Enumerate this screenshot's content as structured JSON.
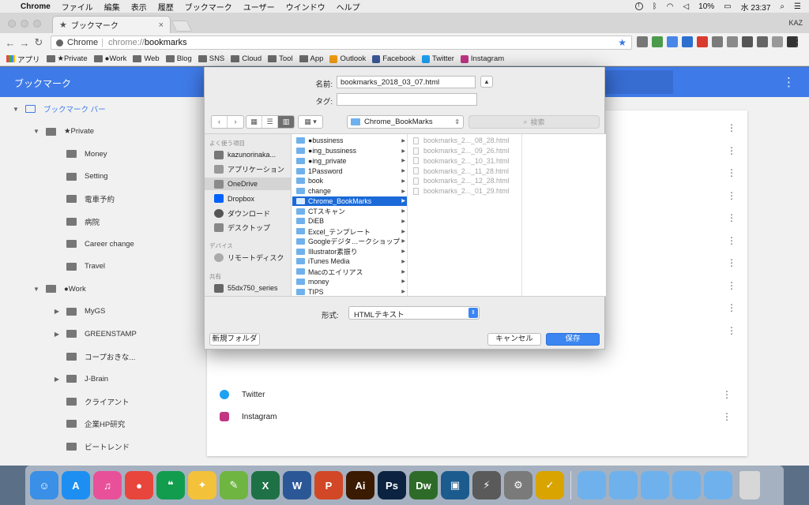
{
  "menubar": {
    "app_name": "Chrome",
    "items": [
      "ファイル",
      "編集",
      "表示",
      "履歴",
      "ブックマーク",
      "ユーザー",
      "ウインドウ",
      "ヘルプ"
    ],
    "battery": "10%",
    "clock": "水 23:37"
  },
  "tab": {
    "title": "ブックマーク",
    "user": "KAZ"
  },
  "omnibox": {
    "site_name": "Chrome",
    "url_scheme": "chrome://",
    "url_host": "bookmarks"
  },
  "bookmarks_bar": {
    "items": [
      {
        "label": "アプリ",
        "icon": "apps-grid-icon"
      },
      {
        "label": "★Private",
        "icon": "folder-icon"
      },
      {
        "label": "●Work",
        "icon": "folder-icon"
      },
      {
        "label": "Web",
        "icon": "folder-icon"
      },
      {
        "label": "Blog",
        "icon": "folder-icon"
      },
      {
        "label": "SNS",
        "icon": "folder-icon"
      },
      {
        "label": "Cloud",
        "icon": "folder-icon"
      },
      {
        "label": "Tool",
        "icon": "folder-icon"
      },
      {
        "label": "App",
        "icon": "folder-icon"
      },
      {
        "label": "Outlook",
        "icon": "outlook-icon"
      },
      {
        "label": "Facebook",
        "icon": "facebook-icon"
      },
      {
        "label": "Twitter",
        "icon": "twitter-icon"
      },
      {
        "label": "Instagram",
        "icon": "instagram-icon"
      }
    ]
  },
  "page": {
    "title": "ブックマーク",
    "tree": [
      {
        "label": "ブックマーク バー",
        "depth": 0,
        "expanded": true,
        "selected": true
      },
      {
        "label": "★Private",
        "depth": 1,
        "expanded": true
      },
      {
        "label": "Money",
        "depth": 2
      },
      {
        "label": "Setting",
        "depth": 2
      },
      {
        "label": "電車予約",
        "depth": 2
      },
      {
        "label": "病院",
        "depth": 2
      },
      {
        "label": "Career change",
        "depth": 2
      },
      {
        "label": "Travel",
        "depth": 2
      },
      {
        "label": "●Work",
        "depth": 1,
        "expanded": true
      },
      {
        "label": "MyGS",
        "depth": 2,
        "collapsed": true
      },
      {
        "label": "GREENSTAMP",
        "depth": 2,
        "collapsed": true
      },
      {
        "label": "コープおきな...",
        "depth": 2
      },
      {
        "label": "J-Brain",
        "depth": 2,
        "collapsed": true
      },
      {
        "label": "クライアント",
        "depth": 2
      },
      {
        "label": "企業HP研究",
        "depth": 2
      },
      {
        "label": "ビートレンド",
        "depth": 2
      }
    ],
    "rows": [
      {
        "label": "Twitter",
        "icon": "twitter-icon"
      },
      {
        "label": "Instagram",
        "icon": "instagram-icon"
      }
    ]
  },
  "dialog": {
    "name_label": "名前:",
    "name_value": "bookmarks_2018_03_07.html",
    "tags_label": "タグ:",
    "tags_value": "",
    "location": "Chrome_BookMarks",
    "search_placeholder": "検索",
    "sidebar": {
      "favorites_head": "よく使う項目",
      "favorites": [
        {
          "label": "kazunorinaka...",
          "icon": "home-icon"
        },
        {
          "label": "アプリケーション",
          "icon": "applications-icon"
        },
        {
          "label": "OneDrive",
          "icon": "folder-icon",
          "active": true
        },
        {
          "label": "Dropbox",
          "icon": "dropbox-icon"
        },
        {
          "label": "ダウンロード",
          "icon": "download-icon"
        },
        {
          "label": "デスクトップ",
          "icon": "desktop-icon"
        }
      ],
      "devices_head": "デバイス",
      "devices": [
        {
          "label": "リモートディスク",
          "icon": "disc-icon"
        }
      ],
      "shared_head": "共有",
      "shared": [
        {
          "label": "55dx750_series",
          "icon": "tv-icon"
        }
      ]
    },
    "folders": [
      "●bussiness",
      "●ing_bussiness",
      "●ing_private",
      "1Password",
      "book",
      "change",
      "Chrome_BookMarks",
      "CTスキャン",
      "DiEB",
      "Excel_テンプレート",
      "Googleデジタ…ークショップ",
      "Illustrator素振り",
      "iTunes Media",
      "Macのエイリアス",
      "money",
      "TIPS"
    ],
    "selected_folder_index": 6,
    "files": [
      "bookmarks_2..._08_28.html",
      "bookmarks_2..._09_26.html",
      "bookmarks_2..._10_31.html",
      "bookmarks_2..._11_28.html",
      "bookmarks_2..._12_28.html",
      "bookmarks_2..._01_29.html"
    ],
    "format_label": "形式:",
    "format_value": "HTMLテキスト",
    "new_folder": "新規フォルダ",
    "cancel": "キャンセル",
    "save": "保存"
  },
  "dock": {
    "items": [
      {
        "name": "finder-icon",
        "glyph": "☺",
        "color": "#3a8fe6"
      },
      {
        "name": "app-store-icon",
        "glyph": "A",
        "color": "#1d8ff2"
      },
      {
        "name": "itunes-icon",
        "glyph": "♫",
        "color": "#e8519a"
      },
      {
        "name": "chrome-icon",
        "glyph": "●",
        "color": "#e8453c"
      },
      {
        "name": "hangouts-icon",
        "glyph": "❝",
        "color": "#129c4e"
      },
      {
        "name": "tips-icon",
        "glyph": "✦",
        "color": "#f3c13a"
      },
      {
        "name": "sketchbook-icon",
        "glyph": "✎",
        "color": "#6fb542"
      },
      {
        "name": "excel-icon",
        "glyph": "X",
        "color": "#1e7145"
      },
      {
        "name": "word-icon",
        "glyph": "W",
        "color": "#2b5797"
      },
      {
        "name": "powerpoint-icon",
        "glyph": "P",
        "color": "#d24726"
      },
      {
        "name": "illustrator-icon",
        "glyph": "Ai",
        "color": "#3a1a00"
      },
      {
        "name": "photoshop-icon",
        "glyph": "Ps",
        "color": "#0b2340"
      },
      {
        "name": "dreamweaver-icon",
        "glyph": "Dw",
        "color": "#2e6b28"
      },
      {
        "name": "screen-app-icon",
        "glyph": "▣",
        "color": "#1c5b8e"
      },
      {
        "name": "launchpad-icon",
        "glyph": "⚡",
        "color": "#5a5a5a"
      },
      {
        "name": "system-preferences-icon",
        "glyph": "⚙",
        "color": "#7a7a7a"
      },
      {
        "name": "norton-icon",
        "glyph": "✓",
        "color": "#d9a400"
      }
    ],
    "stack_items": [
      {
        "name": "downloads-stack-icon",
        "color": "#6fb1ec"
      },
      {
        "name": "icloud-folder-icon",
        "color": "#6fb1ec"
      },
      {
        "name": "dropbox-folder-icon",
        "color": "#6fb1ec"
      },
      {
        "name": "folder-icon",
        "color": "#6fb1ec"
      },
      {
        "name": "folder-icon",
        "color": "#6fb1ec"
      },
      {
        "name": "trash-icon",
        "color": "#d7d7d7"
      }
    ]
  }
}
